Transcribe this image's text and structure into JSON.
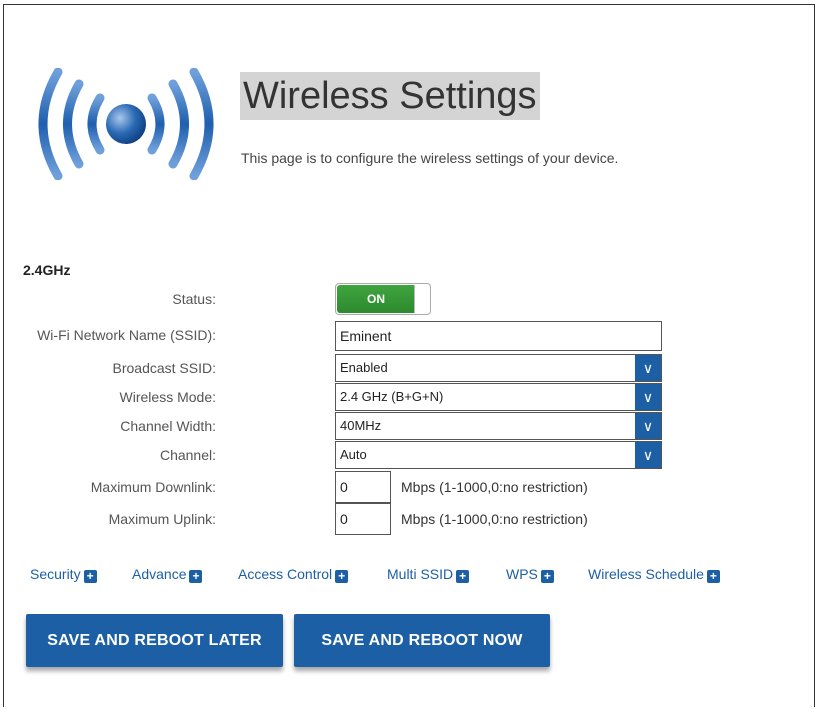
{
  "header": {
    "title": "Wireless Settings",
    "description": "This page is to configure the wireless settings of your device."
  },
  "band": {
    "label": "2.4GHz"
  },
  "form": {
    "status": {
      "label": "Status:",
      "value": "ON",
      "enabled": true
    },
    "ssid": {
      "label": "Wi-Fi Network Name (SSID):",
      "value": "Eminent"
    },
    "broadcast_ssid": {
      "label": "Broadcast SSID:",
      "value": "Enabled"
    },
    "wireless_mode": {
      "label": "Wireless Mode:",
      "value": "2.4 GHz (B+G+N)"
    },
    "channel_width": {
      "label": "Channel Width:",
      "value": "40MHz"
    },
    "channel": {
      "label": "Channel:",
      "value": "Auto"
    },
    "max_downlink": {
      "label": "Maximum Downlink:",
      "value": "0",
      "unit": "Mbps (1-1000,0:no restriction)"
    },
    "max_uplink": {
      "label": "Maximum Uplink:",
      "value": "0",
      "unit": "Mbps (1-1000,0:no restriction)"
    }
  },
  "sections": [
    {
      "label": "Security"
    },
    {
      "label": "Advance"
    },
    {
      "label": "Access Control"
    },
    {
      "label": "Multi SSID"
    },
    {
      "label": "WPS"
    },
    {
      "label": "Wireless Schedule"
    }
  ],
  "buttons": {
    "save_later": "SAVE AND REBOOT LATER",
    "save_now": "SAVE AND REBOOT NOW"
  },
  "icons": {
    "logo": "wireless-signal-icon",
    "dropdown": "chevron-down-icon",
    "expand": "plus-icon"
  },
  "colors": {
    "accent": "#1d5fa5",
    "toggle_on": "#2d8a2d",
    "title_bg": "#d4d4d4"
  }
}
